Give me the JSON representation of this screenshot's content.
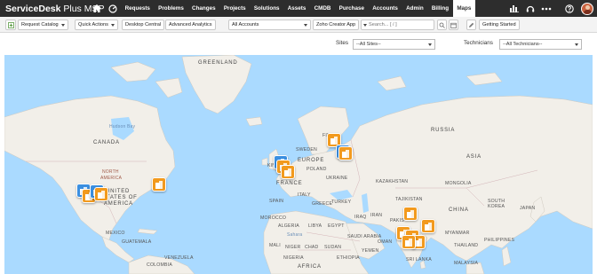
{
  "app": {
    "brand_main": "ServiceDesk",
    "brand_rest": " Plus MSP"
  },
  "nav": {
    "items": [
      "Requests",
      "Problems",
      "Changes",
      "Projects",
      "Solutions",
      "Assets",
      "CMDB",
      "Purchase",
      "Accounts",
      "Admin",
      "Billing",
      "Maps"
    ],
    "active": "Maps"
  },
  "toolbar": {
    "new_label": "",
    "request_catalog": "Request Catalog",
    "quick_actions": "Quick Actions",
    "desktop_central": "Desktop Central",
    "advanced_analytics": "Advanced Analytics",
    "account_select": "All Accounts",
    "zoho_creator": "Zoho Creator App",
    "search_placeholder": "Search... [ / ]",
    "getting_started": "Getting Started"
  },
  "filters": {
    "sites_label": "Sites",
    "sites_value": "--All Sites--",
    "technicians_label": "Technicians",
    "technicians_value": "--All Technicians--"
  },
  "map": {
    "labels": {
      "greenland": "GREENLAND",
      "canada": "CANADA",
      "north_america": "NORTH",
      "north_america2": "AMERICA",
      "united_states": "UNITED",
      "united_states2": "STATES OF",
      "united_states3": "AMERICA",
      "mexico": "MEXICO",
      "guatemala": "GUATEMALA",
      "venezuela": "VENEZUELA",
      "colombia": "COLOMBIA",
      "russia": "RUSSIA",
      "finland": "FINL",
      "sweden": "SWEDEN",
      "united_kingdom": "KIN",
      "poland": "POLAND",
      "ukraine": "UKRAINE",
      "france": "FRANCE",
      "spain": "SPAIN",
      "italy": "ITALY",
      "greece": "GREECE",
      "turkey": "TURKEY",
      "kazakhstan": "KAZAKHSTAN",
      "mongolia": "MONGOLIA",
      "tajikistan": "TAJIKISTAN",
      "china": "CHINA",
      "south_korea": "SOUTH",
      "south_korea2": "KOREA",
      "japan": "JAPAN",
      "iraq": "IRAQ",
      "iran": "IRAN",
      "pakistan": "PAKIS",
      "morocco": "MOROCCO",
      "algeria": "ALGERIA",
      "libya": "LIBYA",
      "egypt": "EGYPT",
      "mali": "MALI",
      "niger": "NIGER",
      "chad": "CHAD",
      "sudan": "SUDAN",
      "nigeria": "NIGERIA",
      "ethiopia": "ETHIOPIA",
      "saudi_arabia": "SAUDI ARABIA",
      "oman": "OMAN",
      "yemen": "YEMEN",
      "sri_lanka": "SRI LANKA",
      "myanmar": "MYANMAR",
      "thailand": "THAILAND",
      "philippines": "PHILIPPINES",
      "malaysia": "MALAYSIA",
      "europe": "EUROPE",
      "africa": "AFRICA",
      "asia": "ASIA",
      "sahara": "Sahara",
      "hudson_bay": "Hudson Bay"
    },
    "marker_color": "#f29a1e",
    "marker_color_alt": "#3b8fe0"
  }
}
